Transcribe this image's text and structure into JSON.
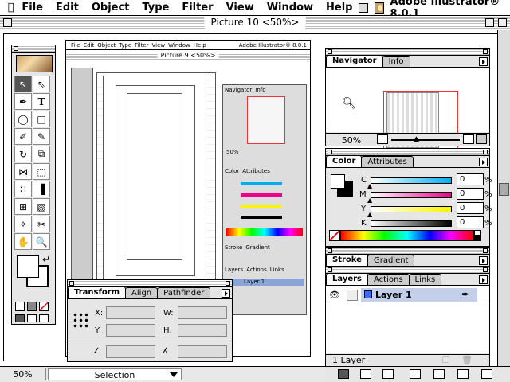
{
  "menubar": {
    "items": [
      "File",
      "Edit",
      "Object",
      "Type",
      "Filter",
      "View",
      "Window",
      "Help"
    ],
    "app_name": "Adobe Illustrator® 8.0.1"
  },
  "window": {
    "title": "Picture 10 <50%>"
  },
  "statusbar": {
    "zoom": "50%",
    "tool_status": "Selection"
  },
  "nested_window": {
    "menu_items": [
      "File",
      "Edit",
      "Object",
      "Type",
      "Filter",
      "View",
      "Window",
      "Help"
    ],
    "app_name": "Adobe Illustrator® 8.0.1",
    "title": "Picture 9 <50%>",
    "nav_tabs": [
      "Navigator",
      "Info"
    ],
    "zoom": "50%",
    "color_tabs": [
      "Color",
      "Attributes"
    ],
    "stroke_tabs": [
      "Stroke",
      "Gradient"
    ],
    "layers_tabs": [
      "Layers",
      "Actions",
      "Links"
    ],
    "layer_name": "Layer 1"
  },
  "transform_palette": {
    "tabs": [
      "Transform",
      "Align",
      "Pathfinder"
    ],
    "x_label": "X:",
    "y_label": "Y:",
    "w_label": "W:",
    "h_label": "H:"
  },
  "navigator_palette": {
    "tabs": [
      "Navigator",
      "Info"
    ],
    "zoom": "50%"
  },
  "color_palette": {
    "tabs": [
      "Color",
      "Attributes"
    ],
    "channels": [
      {
        "label": "C",
        "value": "0",
        "unit": "%",
        "color": "#00aeef"
      },
      {
        "label": "M",
        "value": "0",
        "unit": "%",
        "color": "#ec008c"
      },
      {
        "label": "Y",
        "value": "0",
        "unit": "%",
        "color": "#fff200"
      },
      {
        "label": "K",
        "value": "0",
        "unit": "%",
        "color": "#000000"
      }
    ]
  },
  "stroke_palette": {
    "tabs": [
      "Stroke",
      "Gradient"
    ]
  },
  "layers_palette": {
    "tabs": [
      "Layers",
      "Actions",
      "Links"
    ],
    "layer_name": "Layer 1",
    "layer_color": "#3b6cf7",
    "count": "1 Layer"
  }
}
